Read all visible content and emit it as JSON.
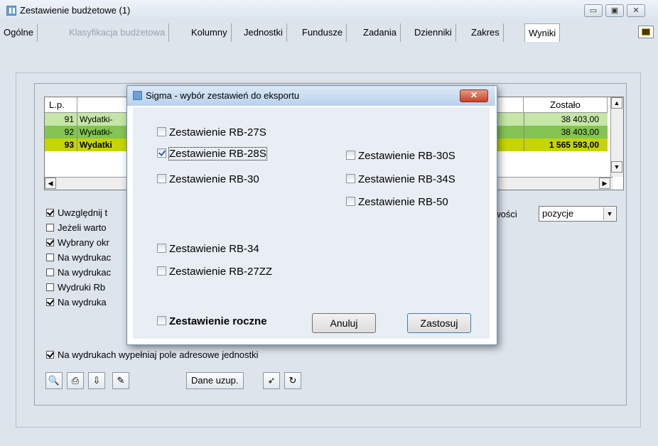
{
  "window": {
    "title": "Zestawienie budżetowe (1)",
    "controls": [
      "minimize-icon",
      "maximize-icon",
      "close-icon"
    ]
  },
  "tabs": [
    {
      "label": "Ogólne"
    },
    {
      "label": "Klasyfikacja budżetowa",
      "disabled": true
    },
    {
      "label": "Kolumny"
    },
    {
      "label": "Jednostki"
    },
    {
      "label": "Fundusze"
    },
    {
      "label": "Zadania"
    },
    {
      "label": "Dzienniki"
    },
    {
      "label": "Zakres"
    },
    {
      "label": "Wyniki",
      "active": true
    }
  ],
  "table": {
    "col_lp": "L.p.",
    "col_zostalo": "Zostało",
    "rows": [
      {
        "lp": "91",
        "name": "Wydatki-",
        "zostalo": "38 403,00"
      },
      {
        "lp": "92",
        "name": "Wydatki-",
        "zostalo": "38 403,00"
      },
      {
        "lp": "93",
        "name": "Wydatki",
        "zostalo": "1 565 593,00"
      }
    ]
  },
  "options": [
    {
      "label": "Uwzględnij t",
      "checked": true
    },
    {
      "label": "Jeżeli warto",
      "checked": false
    },
    {
      "label": "Wybrany okr",
      "checked": true
    },
    {
      "label": "Na wydrukac",
      "checked": false
    },
    {
      "label": "Na wydrukac",
      "checked": false
    },
    {
      "label": "Wydruki Rb",
      "checked": false
    },
    {
      "label": "Na wydruka",
      "checked": true
    },
    {
      "label": "Na wydrukach wypełniaj pole adresowe jednostki",
      "checked": true
    }
  ],
  "select": {
    "label_fragment": "owości",
    "value": "pozycje"
  },
  "toolbar": {
    "dane_uzup": "Dane uzup."
  },
  "dialog": {
    "title": "Sigma - wybór zestawień do eksportu",
    "left_items": [
      {
        "label": "Zestawienie RB-27S",
        "checked": false
      },
      {
        "label": "Zestawienie RB-28S",
        "checked": true
      },
      {
        "label": "Zestawienie RB-30",
        "checked": false
      },
      {
        "label": "Zestawienie RB-34",
        "checked": false
      },
      {
        "label": "Zestawienie RB-27ZZ",
        "checked": false
      }
    ],
    "right_items": [
      {
        "label": "Zestawienie RB-30S",
        "checked": false
      },
      {
        "label": "Zestawienie RB-34S",
        "checked": false
      },
      {
        "label": "Zestawienie RB-50",
        "checked": false
      }
    ],
    "annual": {
      "label": "Zestawienie roczne",
      "checked": false
    },
    "cancel_label": "Anuluj",
    "apply_label": "Zastosuj"
  }
}
